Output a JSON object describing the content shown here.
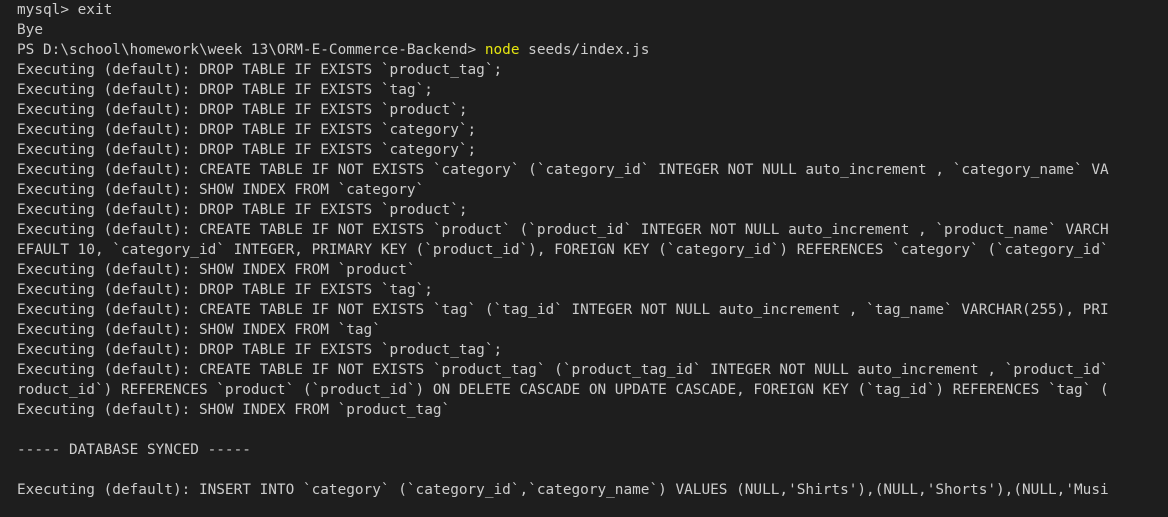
{
  "terminal": {
    "lines": [
      "mysql> exit",
      "Bye",
      "__PROMPT__",
      "Executing (default): DROP TABLE IF EXISTS `product_tag`;",
      "Executing (default): DROP TABLE IF EXISTS `tag`;",
      "Executing (default): DROP TABLE IF EXISTS `product`;",
      "Executing (default): DROP TABLE IF EXISTS `category`;",
      "Executing (default): DROP TABLE IF EXISTS `category`;",
      "Executing (default): CREATE TABLE IF NOT EXISTS `category` (`category_id` INTEGER NOT NULL auto_increment , `category_name` VA",
      "Executing (default): SHOW INDEX FROM `category`",
      "Executing (default): DROP TABLE IF EXISTS `product`;",
      "Executing (default): CREATE TABLE IF NOT EXISTS `product` (`product_id` INTEGER NOT NULL auto_increment , `product_name` VARCH",
      "EFAULT 10, `category_id` INTEGER, PRIMARY KEY (`product_id`), FOREIGN KEY (`category_id`) REFERENCES `category` (`category_id`",
      "Executing (default): SHOW INDEX FROM `product`",
      "Executing (default): DROP TABLE IF EXISTS `tag`;",
      "Executing (default): CREATE TABLE IF NOT EXISTS `tag` (`tag_id` INTEGER NOT NULL auto_increment , `tag_name` VARCHAR(255), PRI",
      "Executing (default): SHOW INDEX FROM `tag`",
      "Executing (default): DROP TABLE IF EXISTS `product_tag`;",
      "Executing (default): CREATE TABLE IF NOT EXISTS `product_tag` (`product_tag_id` INTEGER NOT NULL auto_increment , `product_id`",
      "roduct_id`) REFERENCES `product` (`product_id`) ON DELETE CASCADE ON UPDATE CASCADE, FOREIGN KEY (`tag_id`) REFERENCES `tag` (",
      "Executing (default): SHOW INDEX FROM `product_tag`",
      "",
      "----- DATABASE SYNCED -----",
      "",
      "Executing (default): INSERT INTO `category` (`category_id`,`category_name`) VALUES (NULL,'Shirts'),(NULL,'Shorts'),(NULL,'Musi"
    ],
    "prompt": {
      "path": "PS D:\\school\\homework\\week 13\\ORM-E-Commerce-Backend> ",
      "command": "node",
      "args": " seeds/index.js"
    },
    "colors": {
      "background": "#1e1e1e",
      "text": "#cccccc",
      "command": "#e5e510"
    }
  }
}
